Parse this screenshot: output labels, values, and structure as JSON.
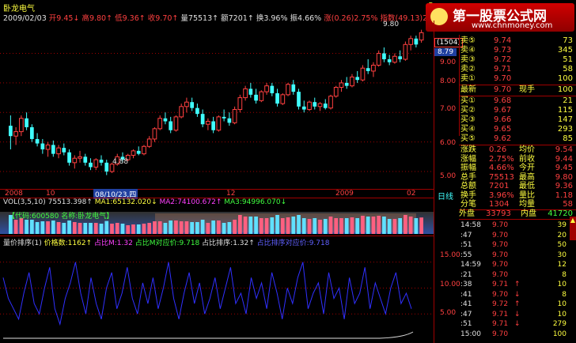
{
  "stock": {
    "name": "卧龙电气",
    "date": "2009/02/03",
    "open_label": "开9.45↓",
    "high_label": "高9.80↑",
    "low_label": "低9.36↑",
    "close_label": "收9.70↑",
    "volume_label": "量75513↑",
    "amount_label": "额7201↑",
    "turnover_label": "换3.96%",
    "amplitude_label": "振4.66%",
    "change_label": "涨(0.26)2.75%",
    "index_label": "指数(49.13)2.44%",
    "badge": "S"
  },
  "watermark": {
    "title": "第一股票公式网",
    "url": "www.chnmoney.com"
  },
  "main_axis": {
    "ticks": [
      "9.00",
      "8.00",
      "7.00",
      "6.00",
      "5.00"
    ],
    "current_box": "(1504)",
    "current_price": "8.79",
    "peak_label": "9.80",
    "low_label": "4.88"
  },
  "x_axis": {
    "labels": [
      "2008",
      "10",
      "08/10/23,四",
      "12",
      "2009",
      "02"
    ],
    "right_label": "日线"
  },
  "vol_panel": {
    "title": "VOL(3,5,10)",
    "v1": "75513.398↑",
    "ma1": "MA1:65132.020↓",
    "ma2": "MA2:74100.672↑",
    "ma3": "MA3:94996.070↓",
    "code_banner": "【代码:600580 名称:卧龙电气】"
  },
  "ind_panel": {
    "title": "量价排序(1)",
    "price_count": "价格数:1162↑",
    "ratio_m": "占比M:1.32",
    "ratio_vol_price": "占比M对应价:9.718",
    "ratio_rank": "占比排序:1.32↑",
    "ratio_rank_price": "占比排序对应价:9.718",
    "ticks": [
      "15.00",
      "10.00",
      "5.00"
    ]
  },
  "order_book": {
    "sells": [
      {
        "label": "卖⑤",
        "price": "9.74",
        "vol": "73"
      },
      {
        "label": "卖④",
        "price": "9.73",
        "vol": "345"
      },
      {
        "label": "卖③",
        "price": "9.72",
        "vol": "51"
      },
      {
        "label": "卖②",
        "price": "9.71",
        "vol": "58"
      },
      {
        "label": "卖①",
        "price": "9.70",
        "vol": "100"
      }
    ],
    "latest": {
      "label": "最新",
      "price": "9.70",
      "hand_label": "现手",
      "hand": "100"
    },
    "buys": [
      {
        "label": "买①",
        "price": "9.68",
        "vol": "21"
      },
      {
        "label": "买②",
        "price": "9.67",
        "vol": "115"
      },
      {
        "label": "买③",
        "price": "9.66",
        "vol": "147"
      },
      {
        "label": "买④",
        "price": "9.65",
        "vol": "293"
      },
      {
        "label": "买⑤",
        "price": "9.62",
        "vol": "85"
      }
    ]
  },
  "stats": [
    {
      "l1": "涨跌",
      "v1": "0.26",
      "l2": "均价",
      "v2": "9.54"
    },
    {
      "l1": "涨幅",
      "v1": "2.75%",
      "l2": "前收",
      "v2": "9.44"
    },
    {
      "l1": "振幅",
      "v1": "4.66%",
      "l2": "今开",
      "v2": "9.45"
    },
    {
      "l1": "总手",
      "v1": "75513",
      "l2": "最高",
      "v2": "9.80"
    },
    {
      "l1": "总额",
      "v1": "7201",
      "l2": "最低",
      "v2": "9.36"
    },
    {
      "l1": "换手",
      "v1": "3.96%",
      "l2": "量比",
      "v2": "1.18"
    },
    {
      "l1": "分笔",
      "v1": "1304",
      "l2": "均量",
      "v2": "58"
    }
  ],
  "outer_inner": {
    "outer_label": "外盘",
    "outer": "33793",
    "inner_label": "内盘",
    "inner": "41720"
  },
  "ticks_list": [
    {
      "time": "14:58",
      "price": "9.70",
      "arrow": "",
      "vol": "39"
    },
    {
      "time": ":47",
      "price": "9.70",
      "arrow": "",
      "vol": "20"
    },
    {
      "time": ":51",
      "price": "9.70",
      "arrow": "",
      "vol": "50"
    },
    {
      "time": ":55",
      "price": "9.70",
      "arrow": "",
      "vol": "30"
    },
    {
      "time": "14:59",
      "price": "9.70",
      "arrow": "",
      "vol": "12"
    },
    {
      "time": ":21",
      "price": "9.70",
      "arrow": "",
      "vol": "8"
    },
    {
      "time": ":38",
      "price": "9.71",
      "arrow": "↑",
      "vol": "10"
    },
    {
      "time": ":41",
      "price": "9.70",
      "arrow": "↓",
      "vol": "8"
    },
    {
      "time": ":41",
      "price": "9.72",
      "arrow": "↑",
      "vol": "10"
    },
    {
      "time": ":47",
      "price": "9.71",
      "arrow": "↓",
      "vol": "10"
    },
    {
      "time": ":51",
      "price": "9.71",
      "arrow": "↓",
      "vol": "279"
    },
    {
      "time": "15:00",
      "price": "9.70",
      "arrow": "",
      "vol": "100"
    }
  ],
  "colors": {
    "up": "#ff4040",
    "down": "#40ffff",
    "grid": "#a00000",
    "ind_line": "#3030ff"
  },
  "candles": [
    {
      "o": 6.55,
      "h": 6.9,
      "l": 5.75,
      "c": 6.2
    },
    {
      "o": 6.2,
      "h": 6.5,
      "l": 5.9,
      "c": 6.35
    },
    {
      "o": 6.35,
      "h": 6.9,
      "l": 6.2,
      "c": 6.8
    },
    {
      "o": 6.8,
      "h": 7.0,
      "l": 6.4,
      "c": 6.5
    },
    {
      "o": 6.5,
      "h": 6.6,
      "l": 6.0,
      "c": 6.1
    },
    {
      "o": 6.1,
      "h": 6.3,
      "l": 5.85,
      "c": 5.95
    },
    {
      "o": 5.95,
      "h": 6.1,
      "l": 5.6,
      "c": 5.75
    },
    {
      "o": 5.75,
      "h": 6.0,
      "l": 5.5,
      "c": 5.9
    },
    {
      "o": 5.9,
      "h": 6.05,
      "l": 5.5,
      "c": 5.6
    },
    {
      "o": 5.6,
      "h": 5.9,
      "l": 5.45,
      "c": 5.8
    },
    {
      "o": 5.8,
      "h": 5.95,
      "l": 5.55,
      "c": 5.65
    },
    {
      "o": 5.65,
      "h": 5.75,
      "l": 5.2,
      "c": 5.3
    },
    {
      "o": 5.3,
      "h": 5.55,
      "l": 5.1,
      "c": 5.45
    },
    {
      "o": 5.45,
      "h": 5.7,
      "l": 5.3,
      "c": 5.5
    },
    {
      "o": 5.5,
      "h": 5.6,
      "l": 5.2,
      "c": 5.3
    },
    {
      "o": 5.3,
      "h": 5.45,
      "l": 5.05,
      "c": 5.15
    },
    {
      "o": 5.15,
      "h": 5.45,
      "l": 5.05,
      "c": 5.4
    },
    {
      "o": 5.4,
      "h": 5.55,
      "l": 5.2,
      "c": 5.3
    },
    {
      "o": 5.3,
      "h": 5.4,
      "l": 4.88,
      "c": 5.0
    },
    {
      "o": 5.0,
      "h": 5.3,
      "l": 4.95,
      "c": 5.25
    },
    {
      "o": 5.25,
      "h": 5.6,
      "l": 5.2,
      "c": 5.5
    },
    {
      "o": 5.5,
      "h": 5.65,
      "l": 5.3,
      "c": 5.4
    },
    {
      "o": 5.4,
      "h": 5.6,
      "l": 5.35,
      "c": 5.55
    },
    {
      "o": 5.55,
      "h": 5.75,
      "l": 5.45,
      "c": 5.7
    },
    {
      "o": 5.7,
      "h": 5.85,
      "l": 5.55,
      "c": 5.6
    },
    {
      "o": 5.6,
      "h": 5.9,
      "l": 5.55,
      "c": 5.85
    },
    {
      "o": 5.85,
      "h": 6.2,
      "l": 5.8,
      "c": 6.1
    },
    {
      "o": 6.1,
      "h": 6.5,
      "l": 6.0,
      "c": 6.45
    },
    {
      "o": 6.45,
      "h": 6.9,
      "l": 6.4,
      "c": 6.8
    },
    {
      "o": 6.8,
      "h": 7.0,
      "l": 6.6,
      "c": 6.7
    },
    {
      "o": 6.7,
      "h": 6.85,
      "l": 6.3,
      "c": 6.4
    },
    {
      "o": 6.4,
      "h": 6.9,
      "l": 6.35,
      "c": 6.85
    },
    {
      "o": 6.85,
      "h": 7.3,
      "l": 6.8,
      "c": 7.2
    },
    {
      "o": 7.2,
      "h": 7.5,
      "l": 7.0,
      "c": 7.35
    },
    {
      "o": 7.35,
      "h": 7.5,
      "l": 7.05,
      "c": 7.15
    },
    {
      "o": 7.15,
      "h": 7.3,
      "l": 6.85,
      "c": 6.95
    },
    {
      "o": 6.95,
      "h": 7.1,
      "l": 6.5,
      "c": 6.6
    },
    {
      "o": 6.6,
      "h": 6.8,
      "l": 6.4,
      "c": 6.7
    },
    {
      "o": 6.7,
      "h": 6.85,
      "l": 6.3,
      "c": 6.4
    },
    {
      "o": 6.4,
      "h": 6.9,
      "l": 6.35,
      "c": 6.85
    },
    {
      "o": 6.85,
      "h": 7.1,
      "l": 6.7,
      "c": 6.8
    },
    {
      "o": 6.8,
      "h": 7.0,
      "l": 6.55,
      "c": 6.65
    },
    {
      "o": 6.65,
      "h": 7.2,
      "l": 6.6,
      "c": 7.1
    },
    {
      "o": 7.1,
      "h": 7.6,
      "l": 7.0,
      "c": 7.5
    },
    {
      "o": 7.5,
      "h": 7.9,
      "l": 7.4,
      "c": 7.8
    },
    {
      "o": 7.8,
      "h": 8.0,
      "l": 7.5,
      "c": 7.6
    },
    {
      "o": 7.6,
      "h": 7.8,
      "l": 7.3,
      "c": 7.4
    },
    {
      "o": 7.4,
      "h": 7.75,
      "l": 7.35,
      "c": 7.7
    },
    {
      "o": 7.7,
      "h": 8.0,
      "l": 7.6,
      "c": 7.9
    },
    {
      "o": 7.9,
      "h": 8.0,
      "l": 7.55,
      "c": 7.65
    },
    {
      "o": 7.65,
      "h": 7.8,
      "l": 7.2,
      "c": 7.3
    },
    {
      "o": 7.3,
      "h": 7.65,
      "l": 7.25,
      "c": 7.6
    },
    {
      "o": 7.6,
      "h": 8.0,
      "l": 7.55,
      "c": 7.95
    },
    {
      "o": 7.95,
      "h": 8.1,
      "l": 7.6,
      "c": 7.7
    },
    {
      "o": 7.7,
      "h": 7.8,
      "l": 7.1,
      "c": 7.2
    },
    {
      "o": 7.2,
      "h": 7.4,
      "l": 7.0,
      "c": 7.1
    },
    {
      "o": 7.1,
      "h": 7.4,
      "l": 7.05,
      "c": 7.35
    },
    {
      "o": 7.35,
      "h": 7.5,
      "l": 7.1,
      "c": 7.2
    },
    {
      "o": 7.2,
      "h": 7.35,
      "l": 7.05,
      "c": 7.3
    },
    {
      "o": 7.3,
      "h": 7.45,
      "l": 7.1,
      "c": 7.15
    },
    {
      "o": 7.15,
      "h": 7.6,
      "l": 7.1,
      "c": 7.55
    },
    {
      "o": 7.55,
      "h": 7.9,
      "l": 7.5,
      "c": 7.85
    },
    {
      "o": 7.85,
      "h": 8.1,
      "l": 7.7,
      "c": 8.0
    },
    {
      "o": 8.0,
      "h": 8.2,
      "l": 7.8,
      "c": 7.9
    },
    {
      "o": 7.9,
      "h": 8.3,
      "l": 7.85,
      "c": 8.2
    },
    {
      "o": 8.2,
      "h": 8.4,
      "l": 8.0,
      "c": 8.1
    },
    {
      "o": 8.1,
      "h": 8.6,
      "l": 8.05,
      "c": 8.5
    },
    {
      "o": 8.5,
      "h": 8.8,
      "l": 8.3,
      "c": 8.4
    },
    {
      "o": 8.4,
      "h": 8.7,
      "l": 8.2,
      "c": 8.6
    },
    {
      "o": 8.6,
      "h": 9.1,
      "l": 8.55,
      "c": 9.0
    },
    {
      "o": 9.0,
      "h": 9.2,
      "l": 8.7,
      "c": 8.8
    },
    {
      "o": 8.8,
      "h": 8.95,
      "l": 8.6,
      "c": 8.7
    },
    {
      "o": 8.7,
      "h": 9.0,
      "l": 8.65,
      "c": 8.9
    },
    {
      "o": 8.9,
      "h": 9.1,
      "l": 8.7,
      "c": 8.8
    },
    {
      "o": 8.8,
      "h": 9.4,
      "l": 8.75,
      "c": 9.3
    },
    {
      "o": 9.3,
      "h": 9.6,
      "l": 9.1,
      "c": 9.5
    },
    {
      "o": 9.5,
      "h": 9.6,
      "l": 9.2,
      "c": 9.3
    },
    {
      "o": 9.45,
      "h": 9.8,
      "l": 9.36,
      "c": 9.7
    }
  ],
  "ind_series": [
    12,
    8,
    6,
    4,
    9,
    13,
    7,
    5,
    10,
    14,
    6,
    3,
    8,
    11,
    15,
    9,
    5,
    12,
    7,
    4,
    10,
    13,
    6,
    9,
    14,
    8,
    5,
    11,
    7,
    12,
    6,
    10,
    15,
    8,
    4,
    9,
    13,
    7,
    11,
    5,
    8,
    12,
    6,
    10,
    14,
    7,
    9,
    5,
    12,
    8,
    11,
    6,
    13,
    9,
    4,
    10,
    7,
    12,
    15,
    6,
    9,
    11,
    5,
    13,
    8,
    10,
    4,
    12,
    7,
    9,
    14,
    6,
    11,
    8,
    5,
    10,
    13,
    7,
    9,
    6
  ]
}
